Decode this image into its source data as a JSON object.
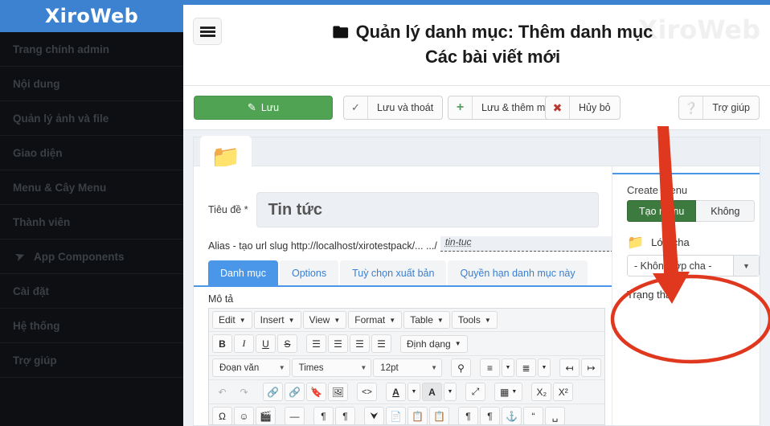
{
  "brand": {
    "name": "XiroWeb",
    "watermark": "XiroWeb",
    "accent": "#3c82d0"
  },
  "sidebar": {
    "items": [
      {
        "label": "Trang chính admin",
        "icon": ""
      },
      {
        "label": "Nội dung",
        "icon": ""
      },
      {
        "label": "Quản lý ảnh và file",
        "icon": ""
      },
      {
        "label": "Giao diện",
        "icon": ""
      },
      {
        "label": "Menu & Cây Menu",
        "icon": ""
      },
      {
        "label": "Thành viên",
        "icon": ""
      },
      {
        "label": "App Components",
        "icon": "paper-plane-icon"
      },
      {
        "label": "Cài đặt",
        "icon": ""
      },
      {
        "label": "Hệ thống",
        "icon": ""
      },
      {
        "label": "Trợ giúp",
        "icon": ""
      }
    ]
  },
  "header": {
    "menu_icon": "hamburger-icon",
    "folder_icon": "folder-icon",
    "title_line1": "Quản lý danh mục: Thêm danh mục",
    "title_line2": "Các bài viết mới"
  },
  "toolbar": {
    "save": {
      "label": "Lưu",
      "icon": "edit-pencil-icon",
      "color": "#4fa352"
    },
    "save_close": {
      "label": "Lưu và thoát",
      "icon": "check-icon"
    },
    "save_new": {
      "label": "Lưu & thêm mới",
      "icon": "plus-icon"
    },
    "cancel": {
      "label": "Hủy bỏ",
      "icon": "times-circle-icon"
    },
    "help": {
      "label": "Trợ giúp",
      "icon": "question-circle-icon"
    }
  },
  "form": {
    "title_label": "Tiêu đề *",
    "title_value": "Tin tức",
    "title_placeholder": "Tiêu đề",
    "alias_label": "Alias - tạo url slug http://localhost/xirotestpack/... .../",
    "alias_value": "tin-tuc"
  },
  "tabs": [
    {
      "label": "Danh mục",
      "active": true
    },
    {
      "label": "Options",
      "active": false
    },
    {
      "label": "Tuỳ chọn xuất bản",
      "active": false
    },
    {
      "label": "Quyền hạn danh mục này",
      "active": false
    }
  ],
  "editor": {
    "field_label": "Mô tả",
    "menubar": [
      "Edit",
      "Insert",
      "View",
      "Format",
      "Table",
      "Tools"
    ],
    "row_format": {
      "bold": "B",
      "italic": "I",
      "underline": "U",
      "strike": "S",
      "align_left": "align-left-icon",
      "align_center": "align-center-icon",
      "align_right": "align-right-icon",
      "align_justify": "align-justify-icon",
      "styles_label": "Định dạng"
    },
    "row_style": {
      "block": "Đoạn văn",
      "font": "Times",
      "size": "12pt",
      "search": "search-replace-icon",
      "bullet_list": "bullet-list-icon",
      "numbered_list": "numbered-list-icon",
      "outdent": "outdent-icon",
      "indent": "indent-icon"
    },
    "row_insert": {
      "undo": "undo-icon",
      "redo": "redo-icon",
      "link": "link-icon",
      "unlink": "unlink-icon",
      "anchor": "anchor-bookmark-icon",
      "image": "image-icon",
      "source": "source-code-icon",
      "text_color": "A",
      "background_color": "A",
      "fullscreen": "fullscreen-icon",
      "table": "table-icon",
      "subscript": "X₂",
      "superscript": "X²"
    },
    "row_extra": {
      "special_char": "special-character-icon",
      "emoticon": "emoticon-icon",
      "media": "media-icon",
      "hr": "horizontal-rule-icon",
      "ltr": "ltr-icon",
      "rtl": "rtl-icon",
      "template": "template-icon",
      "paste": "paste-icon",
      "paste_text": "paste-text-icon",
      "paste_word": "paste-word-icon",
      "para1": "paragraph-icon",
      "para2": "paragraph-icon",
      "anchor2": "anchor-icon",
      "blockquote": "blockquote-icon",
      "visualchars": "visual-chars-icon"
    }
  },
  "right_panel": {
    "create_menu_label": "Create menu",
    "create_menu_yes": "Tạo menu",
    "create_menu_no": "Không",
    "parent_icon": "folder-icon",
    "parent_label": "Lớp cha",
    "parent_value": "- Không lớp cha -",
    "status_label": "Trạng thái"
  },
  "annotation": {
    "arrow_color": "#e0381f",
    "highlight_color": "#e0381f",
    "arrow_label": "red-arrow-pointing-to-create-menu",
    "highlight_label": "red-ellipse-around-create-menu"
  }
}
